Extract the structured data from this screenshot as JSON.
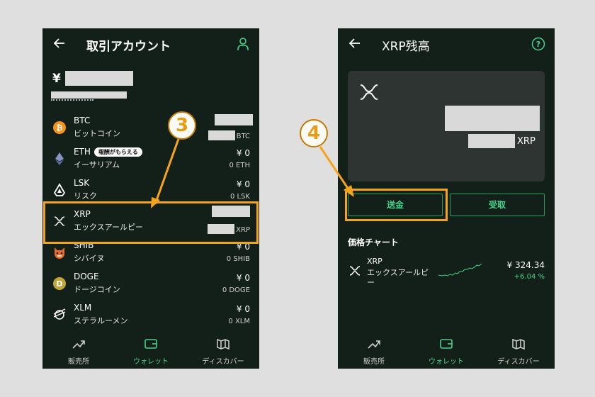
{
  "left": {
    "title": "取引アカウント",
    "currency": "¥",
    "coins": [
      {
        "symbol": "BTC",
        "name": "ビットコイン",
        "amount": "",
        "qty_unit": "BTC"
      },
      {
        "symbol": "ETH",
        "name": "イーサリアム",
        "badge": "報酬がもらえる",
        "amount": "¥ 0",
        "qty": "0 ETH"
      },
      {
        "symbol": "LSK",
        "name": "リスク",
        "amount": "¥ 0",
        "qty": "0 LSK"
      },
      {
        "symbol": "XRP",
        "name": "エックスアールピー",
        "amount": "",
        "qty_unit": "XRP"
      },
      {
        "symbol": "SHIB",
        "name": "シバイヌ",
        "amount": "¥ 0",
        "qty": "0 SHIB"
      },
      {
        "symbol": "DOGE",
        "name": "ドージコイン",
        "amount": "¥ 0",
        "qty": "0 DOGE"
      },
      {
        "symbol": "XLM",
        "name": "ステラルーメン",
        "amount": "¥ 0",
        "qty": "0 XLM"
      }
    ],
    "step": "3"
  },
  "right": {
    "title": "XRP残高",
    "unit": "XRP",
    "send": "送金",
    "receive": "受取",
    "chart_title": "価格チャート",
    "market": {
      "symbol": "XRP",
      "name": "エックスアールピー",
      "price": "¥ 324.34",
      "change": "+6.04 %"
    },
    "step": "4"
  },
  "tabs": [
    "販売所",
    "ウォレット",
    "ディスカバー"
  ],
  "colors": {
    "bg": "#132019",
    "accent": "#44d38a",
    "highlight": "#f5a31a",
    "btc": "#f7931a"
  },
  "icons": [
    "back-arrow-icon",
    "user-icon",
    "help-icon",
    "xrp-icon",
    "chart-icon",
    "wallet-icon",
    "map-icon"
  ]
}
